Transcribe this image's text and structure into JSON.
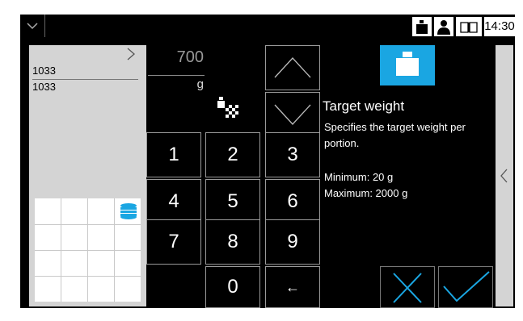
{
  "statusbar": {
    "time": "14:30",
    "icons": [
      "chevron-down-icon",
      "weight-icon",
      "user-icon",
      "book-icon"
    ]
  },
  "left_panel": {
    "line1": "1033",
    "line2": "1033"
  },
  "display": {
    "value": "700",
    "unit": "g"
  },
  "keypad": {
    "keys": [
      "1",
      "2",
      "3",
      "4",
      "5",
      "6",
      "7",
      "8",
      "9",
      "0"
    ],
    "backspace": "←"
  },
  "info": {
    "title": "Target weight",
    "description_line1": "Specifies the target weight per",
    "description_line2": "portion.",
    "minimum": "Minimum: 20 g",
    "maximum": "Maximum: 2000 g"
  },
  "colors": {
    "accent": "#1aa6e2",
    "background": "#000000",
    "panel": "#d4d4d4"
  }
}
